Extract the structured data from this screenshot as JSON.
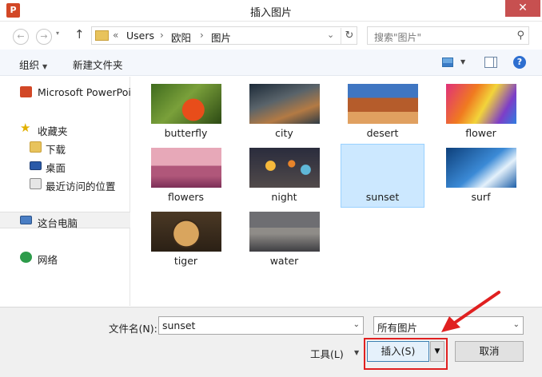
{
  "window": {
    "title": "插入图片",
    "app_icon": "P",
    "close_label": "✕"
  },
  "address": {
    "back_icon": "back-arrow-icon",
    "forward_icon": "forward-arrow-icon",
    "recent_icon": "chevron-down-icon",
    "up_icon": "up-arrow-icon",
    "up_glyph": "↑",
    "back_glyph": "←",
    "forward_glyph": "→",
    "recent_glyph": "▾",
    "overflow": "«",
    "path": [
      "Users",
      "欧阳",
      "图片"
    ],
    "separator": "›",
    "drop_glyph": "⌄",
    "refresh_glyph": "↻"
  },
  "search": {
    "placeholder": "搜索\"图片\"",
    "icon_glyph": "⚲"
  },
  "toolbar": {
    "organize_label": "组织",
    "caret": "▼",
    "new_folder_label": "新建文件夹",
    "help_glyph": "?"
  },
  "nav": {
    "items": [
      {
        "label": "Microsoft PowerPoi",
        "icon": "powerpoint-icon"
      },
      {
        "label": "收藏夹",
        "icon": "favorites-star-icon",
        "glyph": "★"
      },
      {
        "label": "下载",
        "icon": "downloads-folder-icon"
      },
      {
        "label": "桌面",
        "icon": "desktop-icon"
      },
      {
        "label": "最近访问的位置",
        "icon": "recent-places-icon"
      },
      {
        "label": "这台电脑",
        "icon": "this-pc-icon"
      },
      {
        "label": "网络",
        "icon": "network-icon"
      }
    ]
  },
  "files": [
    {
      "name": "butterfly",
      "selected": false
    },
    {
      "name": "city",
      "selected": false
    },
    {
      "name": "desert",
      "selected": false
    },
    {
      "name": "flower",
      "selected": false
    },
    {
      "name": "flowers",
      "selected": false
    },
    {
      "name": "night",
      "selected": false
    },
    {
      "name": "sunset",
      "selected": true
    },
    {
      "name": "surf",
      "selected": false
    },
    {
      "name": "tiger",
      "selected": false
    },
    {
      "name": "water",
      "selected": false
    }
  ],
  "bottom": {
    "filename_label": "文件名(N):",
    "filename_value": "sunset",
    "filetype_value": "所有图片",
    "dropdown_glyph": "⌄",
    "tools_label": "工具(L)",
    "tools_caret": "▼",
    "insert_label": "插入(S)",
    "insert_split_glyph": "▼",
    "cancel_label": "取消"
  },
  "colors": {
    "annotation": "#e02020",
    "selection": "#cce8ff",
    "accent": "#3c7fb1"
  }
}
